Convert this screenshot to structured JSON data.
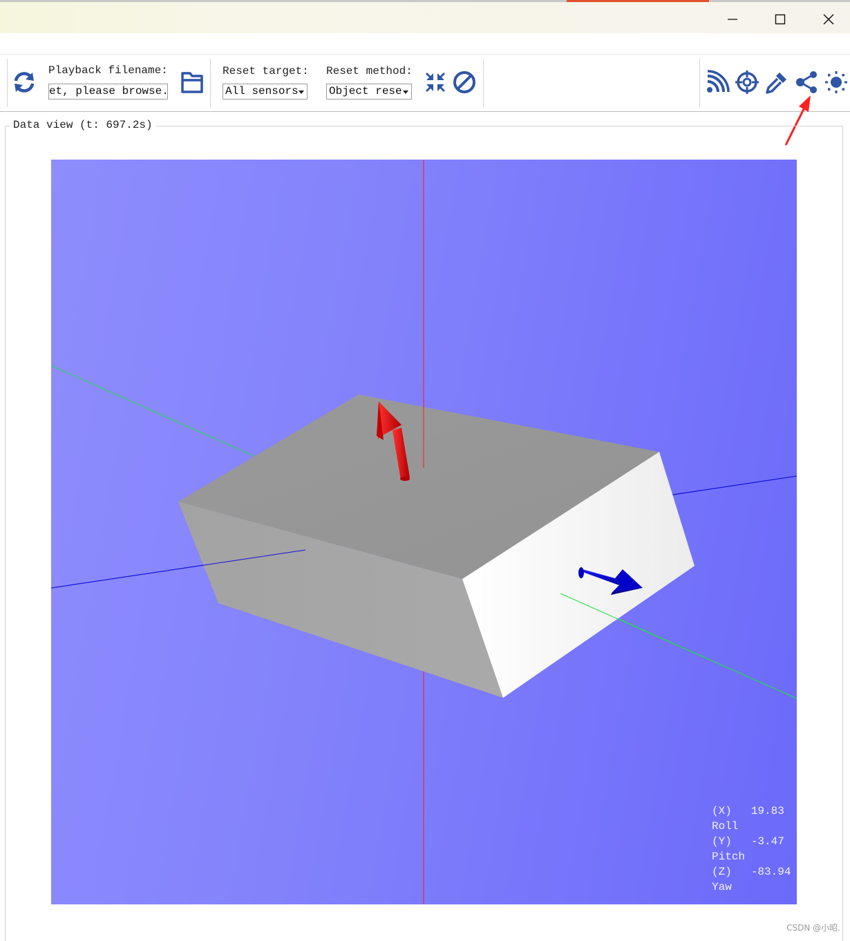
{
  "window": {
    "minimize_icon": "minimize-icon",
    "maximize_icon": "maximize-icon",
    "close_icon": "close-icon"
  },
  "toolbar": {
    "refresh_icon": "refresh-icon",
    "playback_label": "Playback filename:",
    "playback_value": "et, please browse..",
    "browse_icon": "folder-icon",
    "reset_target_label": "Reset target:",
    "reset_target_value": "All sensors",
    "reset_method_label": "Reset method:",
    "reset_method_value": "Object rese",
    "reset_icon": "compress-arrows-icon",
    "cancel_icon": "block-icon",
    "right_icons": [
      "rss-feed-icon",
      "crosshair-icon",
      "dropper-icon",
      "share-icon",
      "brightness-icon"
    ],
    "accent_color": "#2e55a6"
  },
  "data_view": {
    "title": "Data view (t: 697.2s)",
    "background_color": "#8080fb",
    "box_color": "#a8a8a8",
    "readout": [
      {
        "axis": "(X)",
        "name": "Roll",
        "value": "19.83"
      },
      {
        "axis": "(Y)",
        "name": "Pitch",
        "value": "-3.47"
      },
      {
        "axis": "(Z)",
        "name": "Yaw",
        "value": "-83.94"
      }
    ]
  },
  "annotation": {
    "arrow_color": "#ff2020"
  },
  "watermark": "CSDN @小昭."
}
